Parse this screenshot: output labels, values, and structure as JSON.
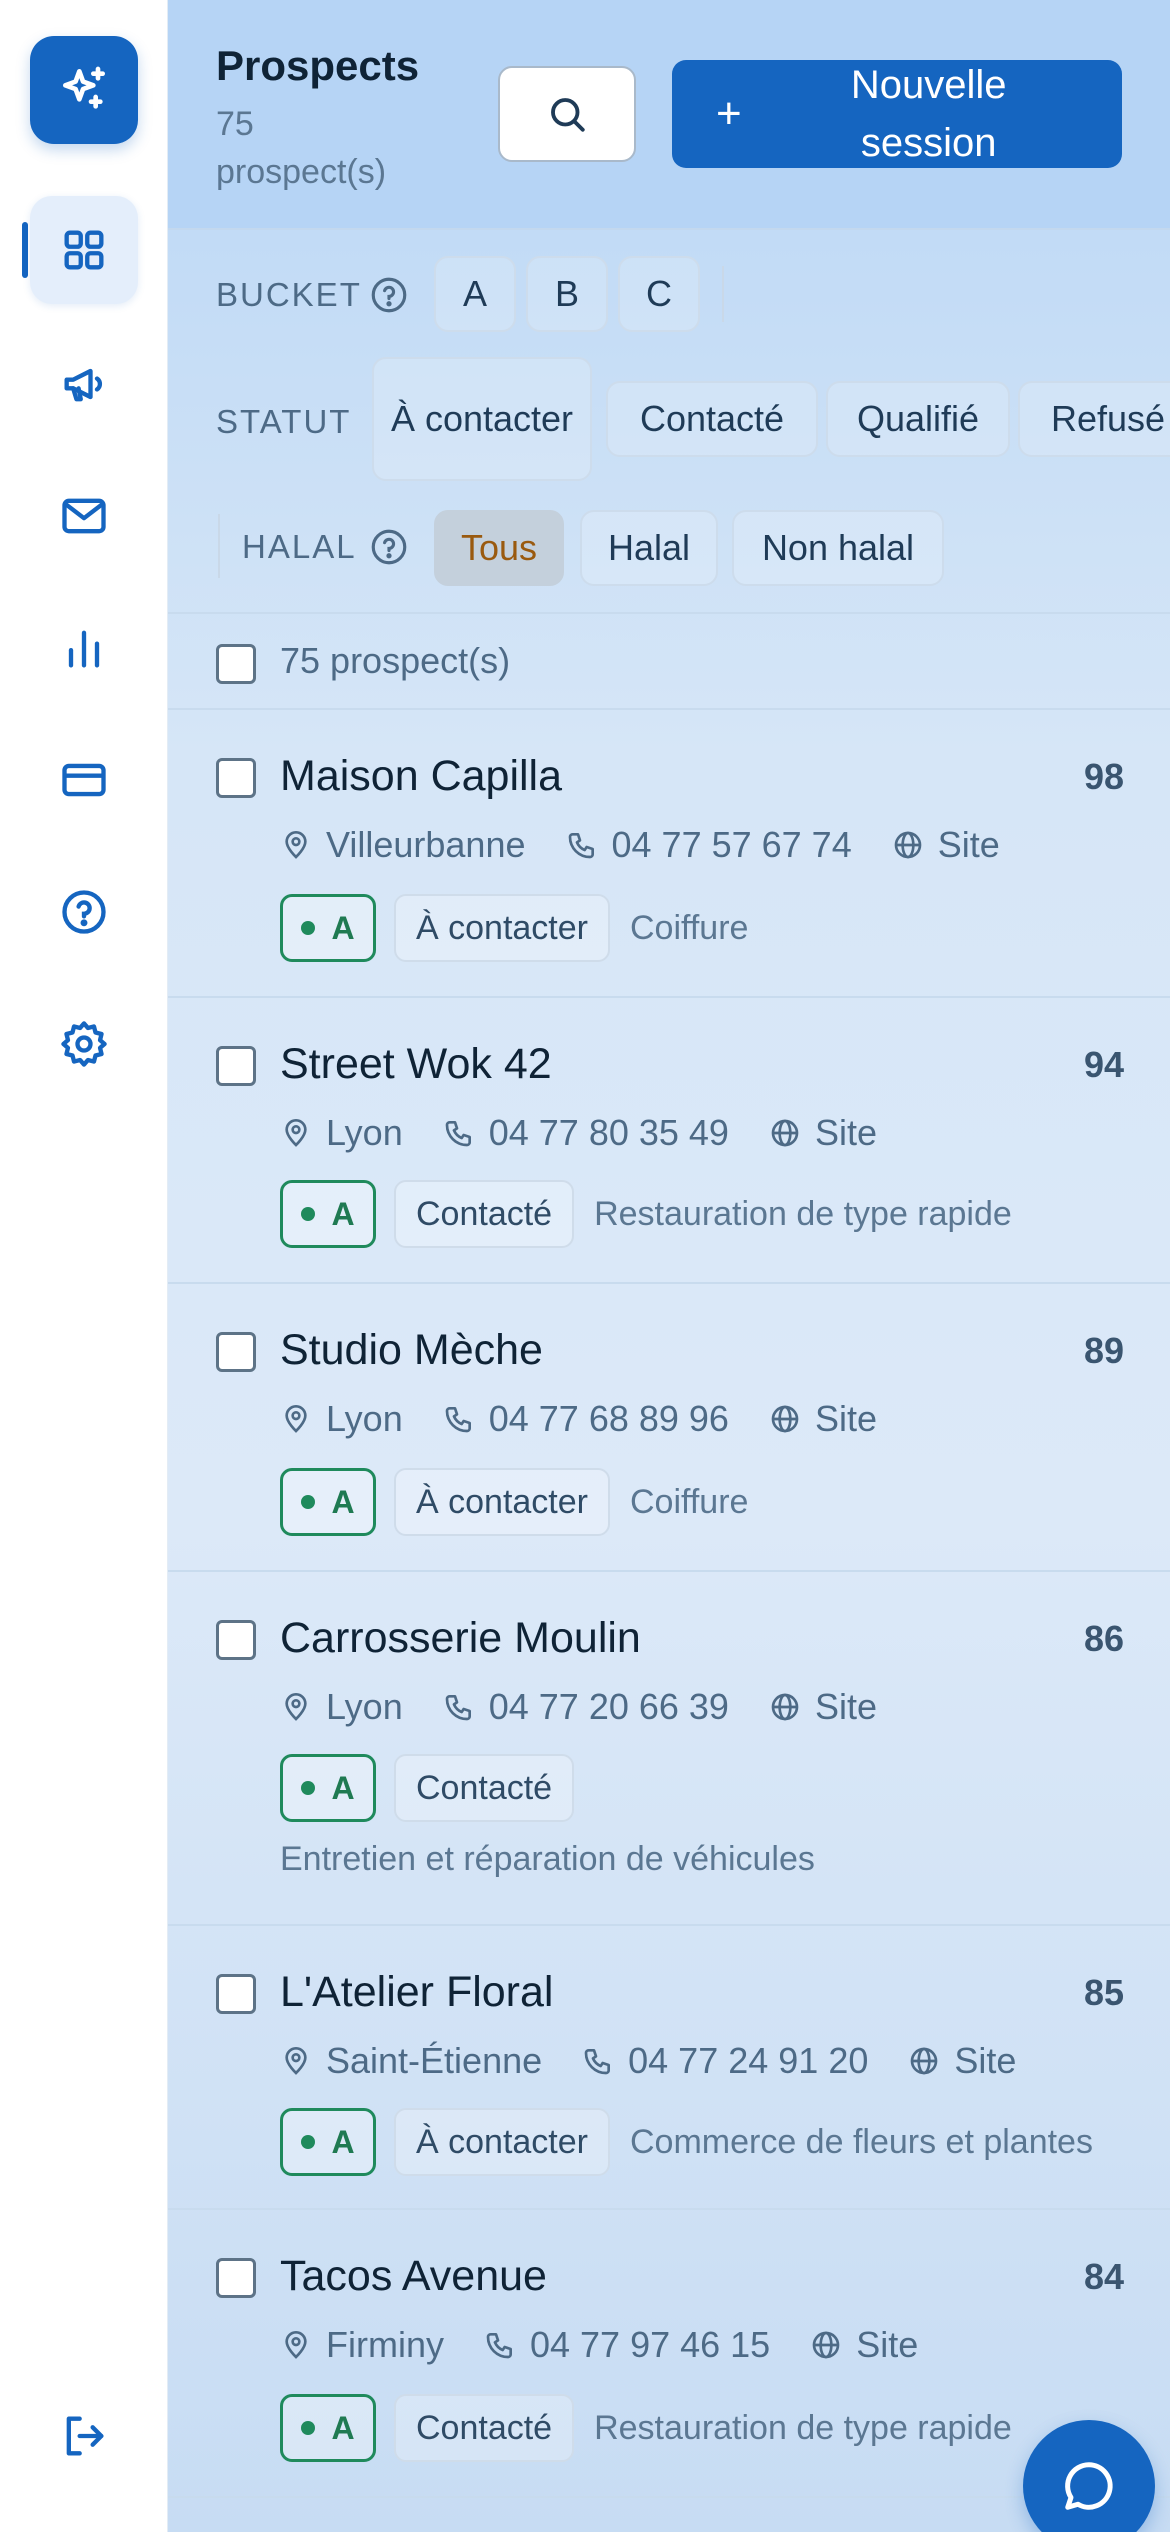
{
  "sidebar": {
    "items": [
      {
        "icon": "grid-icon",
        "active": true
      },
      {
        "icon": "megaphone-icon"
      },
      {
        "icon": "mail-icon"
      },
      {
        "icon": "bar-chart-icon"
      },
      {
        "icon": "credit-card-icon"
      },
      {
        "icon": "help-circle-icon"
      },
      {
        "icon": "gear-icon"
      }
    ],
    "logout_icon": "logout-icon",
    "logo_icon": "sparkles-icon"
  },
  "header": {
    "title": "Prospects",
    "subtitle": "75 prospect(s)",
    "new_session_label": "Nouvelle session"
  },
  "filters": {
    "bucket": {
      "label": "BUCKET",
      "options": [
        "A",
        "B",
        "C"
      ]
    },
    "statut": {
      "label": "STATUT",
      "options": [
        "À contacter",
        "Contacté",
        "Qualifié",
        "Refusé"
      ]
    },
    "halal": {
      "label": "HALAL",
      "options": [
        "Tous",
        "Halal",
        "Non halal"
      ],
      "selected": "Tous"
    }
  },
  "list": {
    "count_label": "75 prospect(s)",
    "rows": [
      {
        "name": "Maison Capilla",
        "score": "98",
        "city": "Villeurbanne",
        "phone": "04 77 57 67 74",
        "site": "Site",
        "bucket": "A",
        "status": "À contacter",
        "category": "Coiffure"
      },
      {
        "name": "Street Wok 42",
        "score": "94",
        "city": "Lyon",
        "phone": "04 77 80 35 49",
        "site": "Site",
        "bucket": "A",
        "status": "Contacté",
        "category": "Restauration de type rapide"
      },
      {
        "name": "Studio Mèche",
        "score": "89",
        "city": "Lyon",
        "phone": "04 77 68 89 96",
        "site": "Site",
        "bucket": "A",
        "status": "À contacter",
        "category": "Coiffure"
      },
      {
        "name": "Carrosserie Moulin",
        "score": "86",
        "city": "Lyon",
        "phone": "04 77 20 66 39",
        "site": "Site",
        "bucket": "A",
        "status": "Contacté",
        "category": "Entretien et réparation de véhicules"
      },
      {
        "name": "L'Atelier Floral",
        "score": "85",
        "city": "Saint-Étienne",
        "phone": "04 77 24 91 20",
        "site": "Site",
        "bucket": "A",
        "status": "À contacter",
        "category": "Commerce de fleurs et plantes"
      },
      {
        "name": "Tacos Avenue",
        "score": "84",
        "city": "Firminy",
        "phone": "04 77 97 46 15",
        "site": "Site",
        "bucket": "A",
        "status": "Contacté",
        "category": "Restauration de type rapide"
      }
    ]
  },
  "colors": {
    "accent": "#1565c0",
    "bucket_green": "#1f8a5c"
  }
}
